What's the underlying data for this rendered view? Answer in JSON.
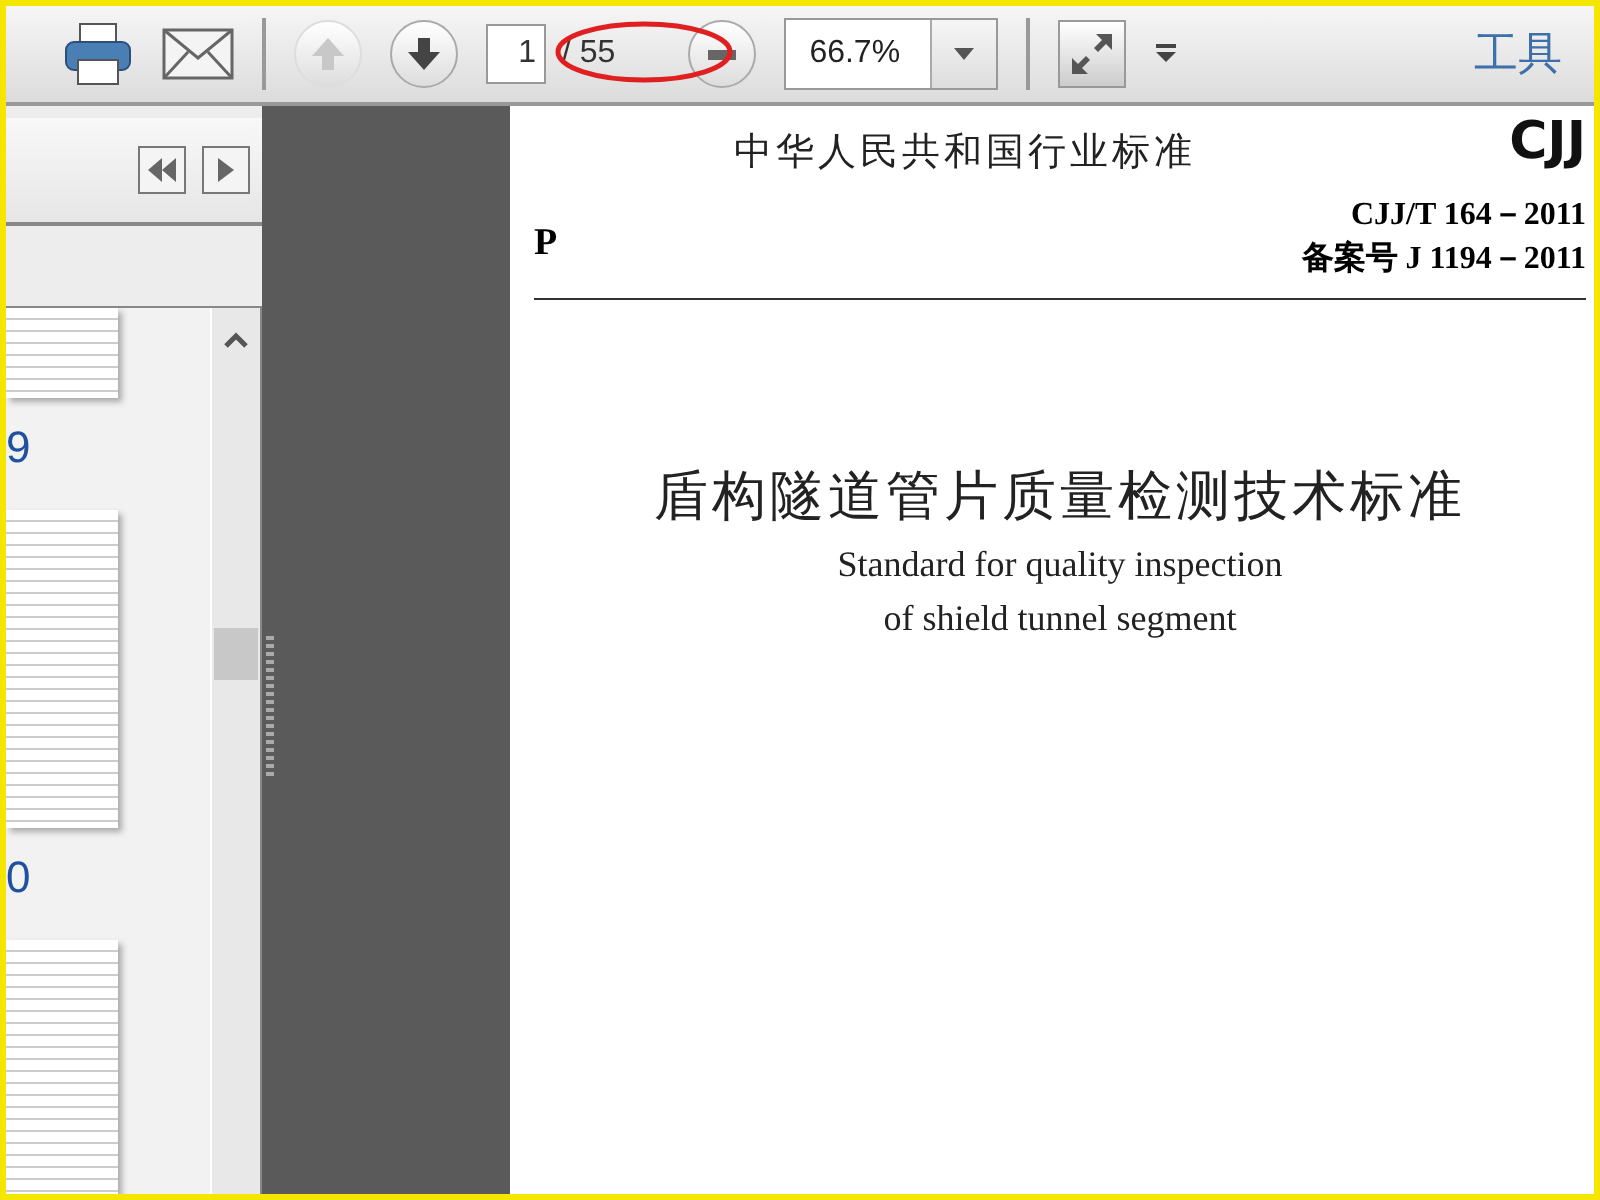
{
  "toolbar": {
    "page_input": "1",
    "page_total": "/ 55",
    "zoom": "66.7%",
    "tools_label": "工具",
    "prev_page_disabled": true
  },
  "thumbnails": [
    {
      "label": "9"
    },
    {
      "label": "0"
    }
  ],
  "document": {
    "header": "中华人民共和国行业标准",
    "logo": "CJJ",
    "category": "P",
    "code": "CJJ/T 164－2011",
    "record": "备案号 J 1194－2011",
    "title": "盾构隧道管片质量检测技术标准",
    "subtitle_lines": [
      "Standard for quality inspection",
      "of shield tunnel segment"
    ]
  }
}
